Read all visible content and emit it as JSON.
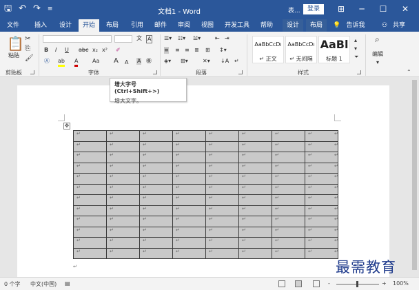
{
  "titlebar": {
    "save_icon": "save-icon",
    "undo_icon": "undo-icon",
    "redo_icon": "redo-icon",
    "window_title": "文档1 - Word",
    "user": "表...",
    "login": "登录",
    "win_buttons": [
      "⊞",
      "─",
      "☐",
      "✕"
    ]
  },
  "tabs": [
    {
      "label": "文件",
      "active": false
    },
    {
      "label": "插入",
      "active": false
    },
    {
      "label": "设计",
      "active": false
    },
    {
      "label": "开始",
      "active": true
    },
    {
      "label": "布局",
      "active": false
    },
    {
      "label": "引用",
      "active": false
    },
    {
      "label": "邮件",
      "active": false
    },
    {
      "label": "审阅",
      "active": false
    },
    {
      "label": "视图",
      "active": false
    },
    {
      "label": "开发工具",
      "active": false
    },
    {
      "label": "帮助",
      "active": false
    },
    {
      "label": "设计",
      "active": false
    },
    {
      "label": "布局",
      "active": false
    }
  ],
  "tellme": "告诉我",
  "share": "共享",
  "ribbon": {
    "clipboard": {
      "paste": "粘贴",
      "group": "剪贴板"
    },
    "font": {
      "group": "字体",
      "bold": "B",
      "italic": "I",
      "underline": "U",
      "strike": "abc",
      "sub": "x₂",
      "sup": "x²",
      "grow_font": "A",
      "shrink_font": "A",
      "aa": "Aa",
      "charA": "A"
    },
    "paragraph": {
      "group": "段落"
    },
    "styles": {
      "group": "样式",
      "items": [
        {
          "sample": "AaBbCcDı",
          "name": "↵ 正文"
        },
        {
          "sample": "AaBbCcDı",
          "name": "↵ 无间隔"
        },
        {
          "sample": "AaBl",
          "name": "标题 1"
        }
      ]
    },
    "editing": {
      "label": "编辑"
    }
  },
  "tooltip": {
    "title": "增大字号 (Ctrl+Shift+>)",
    "desc": "增大文字。"
  },
  "table": {
    "cell_mark": "↵",
    "rows": 12,
    "cols": 8
  },
  "status": {
    "words": "0 个字",
    "lang": "中文(中国)",
    "zoom": "100%",
    "zoom_minus": "-",
    "zoom_plus": "+"
  },
  "watermark": "最需教育"
}
